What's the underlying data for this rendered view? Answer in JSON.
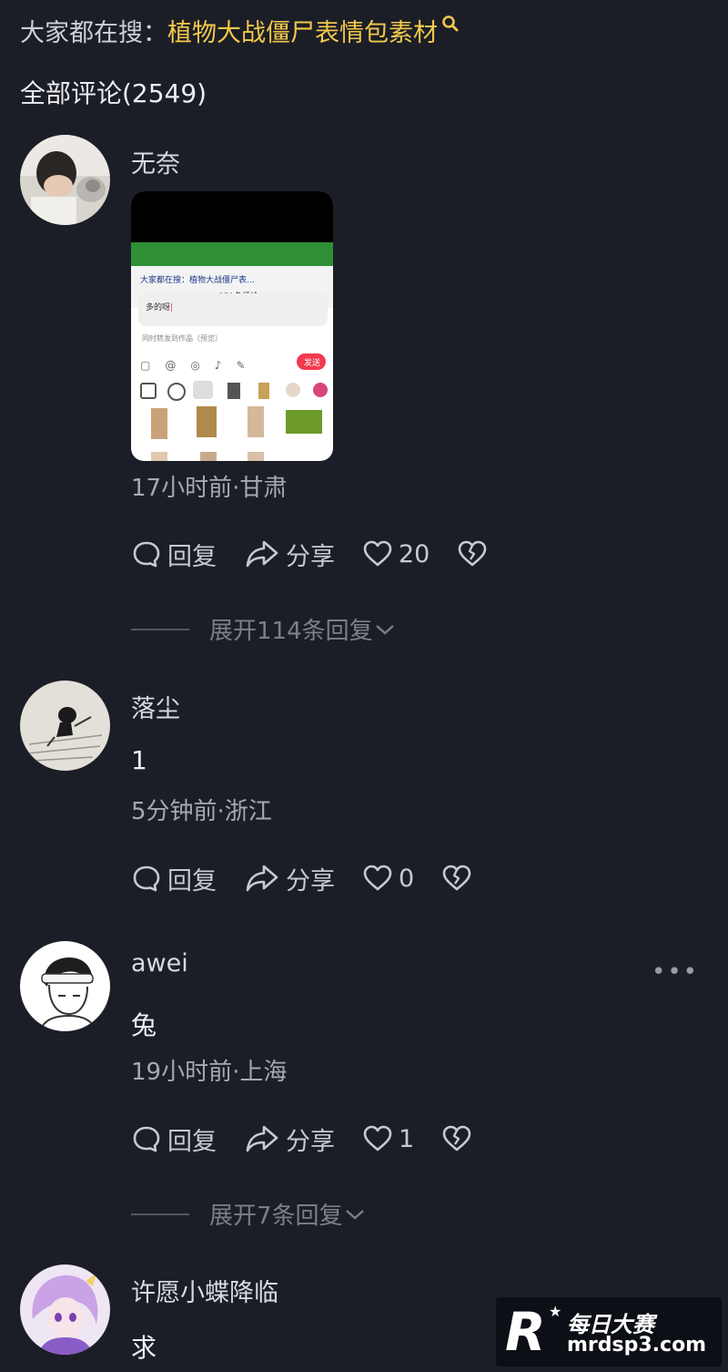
{
  "search": {
    "prefix": "大家都在搜：",
    "keyword": "植物大战僵尸表情包素材"
  },
  "comments_title": "全部评论(2549)",
  "actions": {
    "reply": "回复",
    "share": "分享"
  },
  "comments": [
    {
      "name": "无奈",
      "time_location": "17小时前·甘肃",
      "likes": "20",
      "expand": "展开114条回复",
      "image": {
        "title": "大家都在搜：植物大战僵尸表...",
        "subtitle": "851条评论",
        "input": "多的呀",
        "option": "同时转发到作品（预览）",
        "send": "发送"
      }
    },
    {
      "name": "落尘",
      "text": "1",
      "time_location": "5分钟前·浙江",
      "likes": "0"
    },
    {
      "name": "awei",
      "text": "兔",
      "time_location": "19小时前·上海",
      "likes": "1",
      "expand": "展开7条回复",
      "more": "•••"
    },
    {
      "name": "许愿小蝶降临",
      "text": "求"
    }
  ],
  "watermark": {
    "cn": "每日大赛",
    "url": "mrdsp3.com",
    "logo": "R"
  },
  "colors": {
    "background": "#1c1e27",
    "keyword": "#f2c84b",
    "send": "#f1394f"
  }
}
